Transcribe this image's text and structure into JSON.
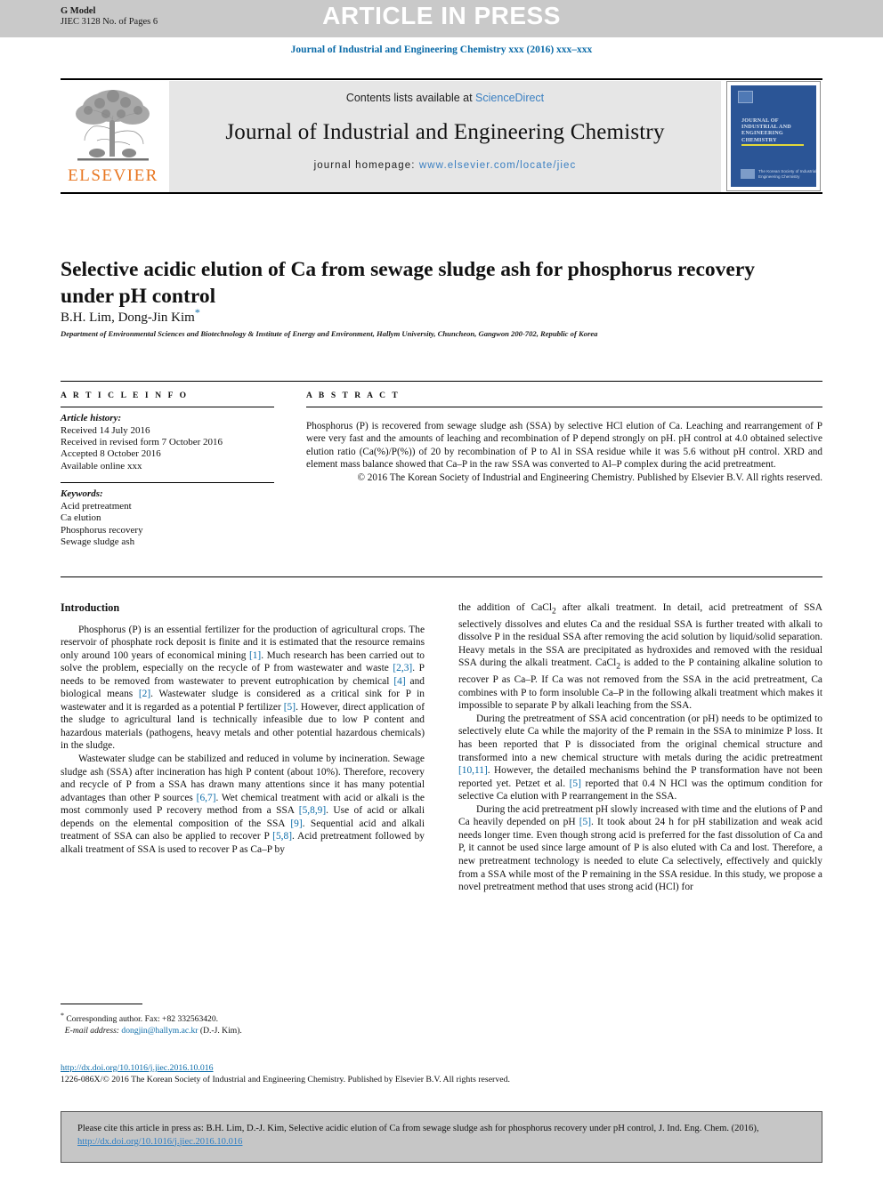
{
  "header": {
    "g_model_label": "G Model",
    "g_model_id": "JIEC 3128 No. of Pages 6",
    "article_in_press": "ARTICLE IN PRESS",
    "running_head": "Journal of Industrial and Engineering Chemistry xxx (2016) xxx–xxx",
    "band_color": "#c9c9c9",
    "link_color": "#0b6ba8"
  },
  "masthead": {
    "contents_label": "Contents lists available at ",
    "sciencedirect": "ScienceDirect",
    "journal_title": "Journal of Industrial and Engineering Chemistry",
    "homepage_label": "journal homepage: ",
    "homepage_url": "www.elsevier.com/locate/jiec",
    "publisher_logo_text": "ELSEVIER",
    "publisher_logo_color": "#E87722",
    "cover_title": "Journal of Industrial and Engineering Chemistry",
    "cover_footer": "The Korean Society of Industrial and Engineering Chemistry",
    "cover_color": "#2b5596"
  },
  "article": {
    "title": "Selective acidic elution of Ca from sewage sludge ash for phosphorus recovery under pH control",
    "authors": "B.H. Lim, Dong-Jin Kim",
    "corresponding_marker": "*",
    "affiliation": "Department of Environmental Sciences and Biotechnology & Institute of Energy and Environment, Hallym University, Chuncheon, Gangwon 200-702, Republic of Korea"
  },
  "article_info": {
    "heading": "A R T I C L E   I N F O",
    "history_label": "Article history:",
    "history": [
      "Received 14 July 2016",
      "Received in revised form 7 October 2016",
      "Accepted 8 October 2016",
      "Available online xxx"
    ],
    "keywords_label": "Keywords:",
    "keywords": [
      "Acid pretreatment",
      "Ca elution",
      "Phosphorus recovery",
      "Sewage sludge ash"
    ]
  },
  "abstract": {
    "heading": "A B S T R A C T",
    "text": "Phosphorus (P) is recovered from sewage sludge ash (SSA) by selective HCl elution of Ca. Leaching and rearrangement of P were very fast and the amounts of leaching and recombination of P depend strongly on pH. pH control at 4.0 obtained selective elution ratio (Ca(%)/P(%)) of 20 by recombination of P to Al in SSA residue while it was 5.6 without pH control. XRD and element mass balance showed that Ca–P in the raw SSA was converted to Al–P complex during the acid pretreatment.",
    "copyright": "© 2016 The Korean Society of Industrial and Engineering Chemistry. Published by Elsevier B.V. All rights reserved."
  },
  "body": {
    "section_heading": "Introduction",
    "left_paragraphs": [
      {
        "pre": "Phosphorus (P) is an essential fertilizer for the production of agricultural crops. The reservoir of phosphate rock deposit is finite and it is estimated that the resource remains only around 100 years of economical mining ",
        "segments": [
          {
            "ref": "[1]",
            "text": ". Much research has been carried out to solve the problem, especially on the recycle of P from wastewater and waste "
          },
          {
            "ref": "[2,3]",
            "text": ". P needs to be removed from wastewater to prevent eutrophication by chemical "
          },
          {
            "ref": "[4]",
            "text": " and biological means "
          },
          {
            "ref": "[2]",
            "text": ". Wastewater sludge is considered as a critical sink for P in wastewater and it is regarded as a potential P fertilizer "
          },
          {
            "ref": "[5]",
            "text": ". However, direct application of the sludge to agricultural land is technically infeasible due to low P content and hazardous materials (pathogens, heavy metals and other potential hazardous chemicals) in the sludge."
          }
        ]
      },
      {
        "pre": "Wastewater sludge can be stabilized and reduced in volume by incineration. Sewage sludge ash (SSA) after incineration has high P content (about 10%). Therefore, recovery and recycle of P from a SSA has drawn many attentions since it has many potential advantages than other P sources ",
        "segments": [
          {
            "ref": "[6,7]",
            "text": ". Wet chemical treatment with acid or alkali is the most commonly used P recovery method from a SSA "
          },
          {
            "ref": "[5,8,9]",
            "text": ". Use of acid or alkali depends on the elemental composition of the SSA "
          },
          {
            "ref": "[9]",
            "text": ". Sequential acid and alkali treatment of SSA can also be applied to recover P "
          },
          {
            "ref": "[5,8]",
            "text": ". Acid pretreatment followed by alkali treatment of SSA is used to recover P as Ca–P by"
          }
        ]
      }
    ],
    "right_paragraphs": [
      {
        "pre": "the addition of CaCl",
        "sub": "2",
        "segments": [
          {
            "ref": "",
            "text": " after alkali treatment. In detail, acid pretreatment of SSA selectively dissolves and elutes Ca and the residual SSA is further treated with alkali to dissolve P in the residual SSA after removing the acid solution by liquid/solid separation. Heavy metals in the SSA are precipitated as hydroxides and removed with the residual SSA during the alkali treatment. CaCl"
          },
          {
            "sub2": "2",
            "text": " is added to the P containing alkaline solution to recover P as Ca–P. If Ca was not removed from the SSA in the acid pretreatment, Ca combines with P to form insoluble Ca–P in the following alkali treatment which makes it impossible to separate P by alkali leaching from the SSA."
          }
        ]
      },
      {
        "pre": "During the pretreatment of SSA acid concentration (or pH) needs to be optimized to selectively elute Ca while the majority of the P remain in the SSA to minimize P loss. It has been reported that P is dissociated from the original chemical structure and transformed into a new chemical structure with metals during the acidic pretreatment ",
        "segments": [
          {
            "ref": "[10,11]",
            "text": ". However, the detailed mechanisms behind the P transformation have not been reported yet. Petzet et al. "
          },
          {
            "ref": "[5]",
            "text": " reported that 0.4 N HCl was the optimum condition for selective Ca elution with P rearrangement in the SSA."
          }
        ]
      },
      {
        "pre": "During the acid pretreatment pH slowly increased with time and the elutions of P and Ca heavily depended on pH ",
        "segments": [
          {
            "ref": "[5]",
            "text": ". It took about 24 h for pH stabilization and weak acid needs longer time. Even though strong acid is preferred for the fast dissolution of Ca and P, it cannot be used since large amount of P is also eluted with Ca and lost. Therefore, a new pretreatment technology is needed to elute Ca selectively, effectively and quickly from a SSA while most of the P remaining in the SSA residue. In this study, we propose a novel pretreatment method that uses strong acid (HCl) for"
          }
        ]
      }
    ]
  },
  "footnote": {
    "marker": "*",
    "corresponding": "Corresponding author. Fax: +82 332563420.",
    "email_label": "E-mail address: ",
    "email": "dongjin@hallym.ac.kr",
    "email_suffix": " (D.-J. Kim)."
  },
  "page_footer": {
    "doi": "http://dx.doi.org/10.1016/j.jiec.2016.10.016",
    "issn_line": "1226-086X/© 2016 The Korean Society of Industrial and Engineering Chemistry. Published by Elsevier B.V. All rights reserved."
  },
  "citation_box": {
    "text_before": "Please cite this article in press as: B.H. Lim, D.-J. Kim, Selective acidic elution of Ca from sewage sludge ash for phosphorus recovery under pH control, J. Ind. Eng. Chem. (2016), ",
    "doi": "http://dx.doi.org/10.1016/j.jiec.2016.10.016",
    "background": "#c6c6c6"
  }
}
